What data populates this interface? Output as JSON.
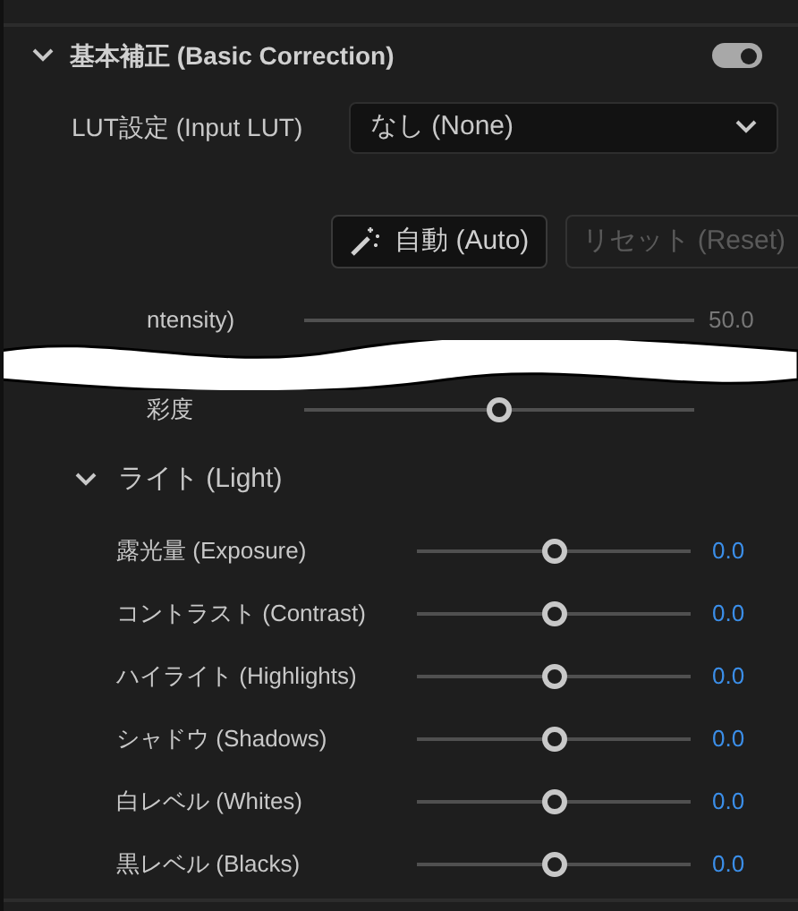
{
  "section": {
    "title": "基本補正 (Basic Correction)",
    "expanded": true,
    "enabled": true
  },
  "lut": {
    "label": "LUT設定 (Input LUT)",
    "value": "なし (None)"
  },
  "buttons": [
    {
      "label": "自動 (Auto)",
      "disabled": false,
      "kind": "auto"
    },
    {
      "label": "リセット (Reset)",
      "disabled": true,
      "kind": "reset"
    }
  ],
  "cut_rows": [
    {
      "label": "ntensity)",
      "value": "50.0",
      "kind": "track"
    },
    {
      "label": "彩度",
      "kind": "thumb",
      "level": 0.5
    }
  ],
  "light": {
    "title": "ライト (Light)",
    "expanded": true,
    "sliders": [
      {
        "label": "露光量 (Exposure)",
        "level": 0.5,
        "value": "0.0"
      },
      {
        "label": "コントラスト (Contrast)",
        "level": 0.5,
        "value": "0.0"
      },
      {
        "label": "ハイライト (Highlights)",
        "level": 0.5,
        "value": "0.0"
      },
      {
        "label": "シャドウ (Shadows)",
        "level": 0.5,
        "value": "0.0"
      },
      {
        "label": "白レベル (Whites)",
        "level": 0.5,
        "value": "0.0"
      },
      {
        "label": "黒レベル (Blacks)",
        "level": 0.5,
        "value": "0.0"
      }
    ]
  }
}
